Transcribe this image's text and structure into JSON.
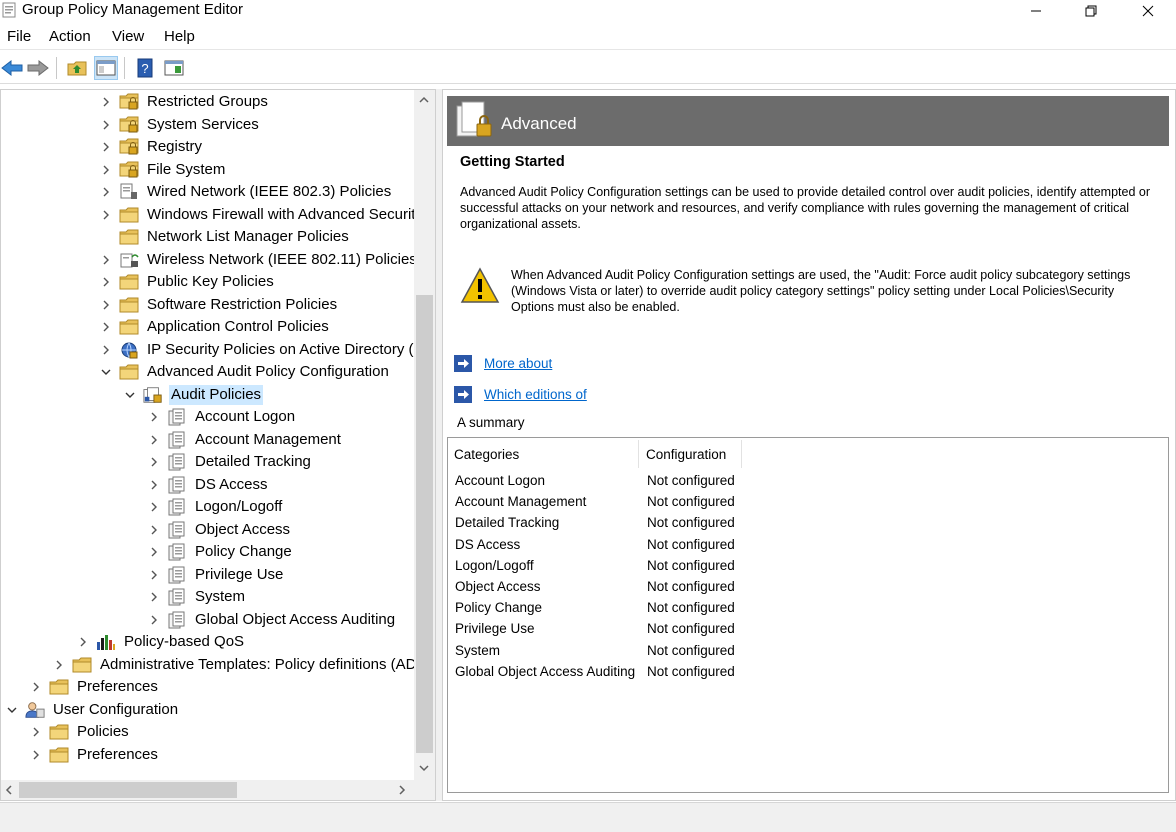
{
  "window": {
    "title": "Group Policy Management Editor"
  },
  "menu": [
    "File",
    "Action",
    "View",
    "Help"
  ],
  "tree": [
    {
      "label": "Restricted Groups",
      "level": 4,
      "expander": "collapsed",
      "icon": "folder-lock-icon"
    },
    {
      "label": "System Services",
      "level": 4,
      "expander": "collapsed",
      "icon": "folder-lock-icon"
    },
    {
      "label": "Registry",
      "level": 4,
      "expander": "collapsed",
      "icon": "folder-lock-icon"
    },
    {
      "label": "File System",
      "level": 4,
      "expander": "collapsed",
      "icon": "folder-lock-icon"
    },
    {
      "label": "Wired Network (IEEE 802.3) Policies",
      "level": 4,
      "expander": "collapsed",
      "icon": "wired-network-icon"
    },
    {
      "label": "Windows Firewall with Advanced Securit",
      "level": 4,
      "expander": "collapsed",
      "icon": "folder-icon"
    },
    {
      "label": "Network List Manager Policies",
      "level": 4,
      "expander": "none",
      "icon": "folder-icon"
    },
    {
      "label": "Wireless Network (IEEE 802.11) Policies",
      "level": 4,
      "expander": "collapsed",
      "icon": "wireless-network-icon"
    },
    {
      "label": "Public Key Policies",
      "level": 4,
      "expander": "collapsed",
      "icon": "folder-icon"
    },
    {
      "label": "Software Restriction Policies",
      "level": 4,
      "expander": "collapsed",
      "icon": "folder-icon"
    },
    {
      "label": "Application Control Policies",
      "level": 4,
      "expander": "collapsed",
      "icon": "folder-icon"
    },
    {
      "label": "IP Security Policies on Active Directory (I",
      "level": 4,
      "expander": "collapsed",
      "icon": "ip-security-icon"
    },
    {
      "label": "Advanced Audit Policy Configuration",
      "level": 4,
      "expander": "expanded",
      "icon": "folder-icon"
    },
    {
      "label": "Audit Policies",
      "level": 5,
      "expander": "expanded",
      "icon": "audit-policies-icon",
      "selected": true
    },
    {
      "label": "Account Logon",
      "level": 6,
      "expander": "collapsed",
      "icon": "policy-sheet-icon"
    },
    {
      "label": "Account Management",
      "level": 6,
      "expander": "collapsed",
      "icon": "policy-sheet-icon"
    },
    {
      "label": "Detailed Tracking",
      "level": 6,
      "expander": "collapsed",
      "icon": "policy-sheet-icon"
    },
    {
      "label": "DS Access",
      "level": 6,
      "expander": "collapsed",
      "icon": "policy-sheet-icon"
    },
    {
      "label": "Logon/Logoff",
      "level": 6,
      "expander": "collapsed",
      "icon": "policy-sheet-icon"
    },
    {
      "label": "Object Access",
      "level": 6,
      "expander": "collapsed",
      "icon": "policy-sheet-icon"
    },
    {
      "label": "Policy Change",
      "level": 6,
      "expander": "collapsed",
      "icon": "policy-sheet-icon"
    },
    {
      "label": "Privilege Use",
      "level": 6,
      "expander": "collapsed",
      "icon": "policy-sheet-icon"
    },
    {
      "label": "System",
      "level": 6,
      "expander": "collapsed",
      "icon": "policy-sheet-icon"
    },
    {
      "label": "Global Object Access Auditing",
      "level": 6,
      "expander": "collapsed",
      "icon": "policy-sheet-icon"
    },
    {
      "label": "Policy-based QoS",
      "level": 3,
      "expander": "collapsed",
      "icon": "bar-chart-icon"
    },
    {
      "label": "Administrative Templates: Policy definitions (AD",
      "level": 2,
      "expander": "collapsed",
      "icon": "folder-icon"
    },
    {
      "label": "Preferences",
      "level": 1,
      "expander": "collapsed",
      "icon": "folder-icon"
    },
    {
      "label": "User Configuration",
      "level": 0,
      "expander": "expanded",
      "icon": "user-config-icon"
    },
    {
      "label": "Policies",
      "level": 1,
      "expander": "collapsed",
      "icon": "folder-icon"
    },
    {
      "label": "Preferences",
      "level": 1,
      "expander": "collapsed",
      "icon": "folder-icon"
    }
  ],
  "details": {
    "banner_title": "Advanced",
    "heading": "Getting Started",
    "intro": "Advanced Audit Policy Configuration settings can be used to provide detailed control over audit policies, identify attempted or successful attacks on your network and resources, and verify compliance with rules governing the management of critical organizational assets.",
    "warning": "When Advanced Audit Policy Configuration settings are used, the \"Audit: Force audit policy subcategory settings (Windows Vista or later) to override audit policy category settings\" policy setting under Local Policies\\Security Options must also be enabled.",
    "link_more": "More about",
    "link_editions": "Which editions of",
    "summary_label": "A summary",
    "table": {
      "headers": [
        "Categories",
        "Configuration"
      ],
      "rows": [
        [
          "Account Logon",
          "Not configured"
        ],
        [
          "Account Management",
          "Not configured"
        ],
        [
          "Detailed Tracking",
          "Not configured"
        ],
        [
          "DS Access",
          "Not configured"
        ],
        [
          "Logon/Logoff",
          "Not configured"
        ],
        [
          "Object Access",
          "Not configured"
        ],
        [
          "Policy Change",
          "Not configured"
        ],
        [
          "Privilege Use",
          "Not configured"
        ],
        [
          "System",
          "Not configured"
        ],
        [
          "Global Object Access Auditing",
          "Not configured"
        ]
      ]
    }
  },
  "colors": {
    "selection": "#cce8ff",
    "banner": "#6c6c6c",
    "link": "#0066cc",
    "folder": "#e8c15a"
  }
}
